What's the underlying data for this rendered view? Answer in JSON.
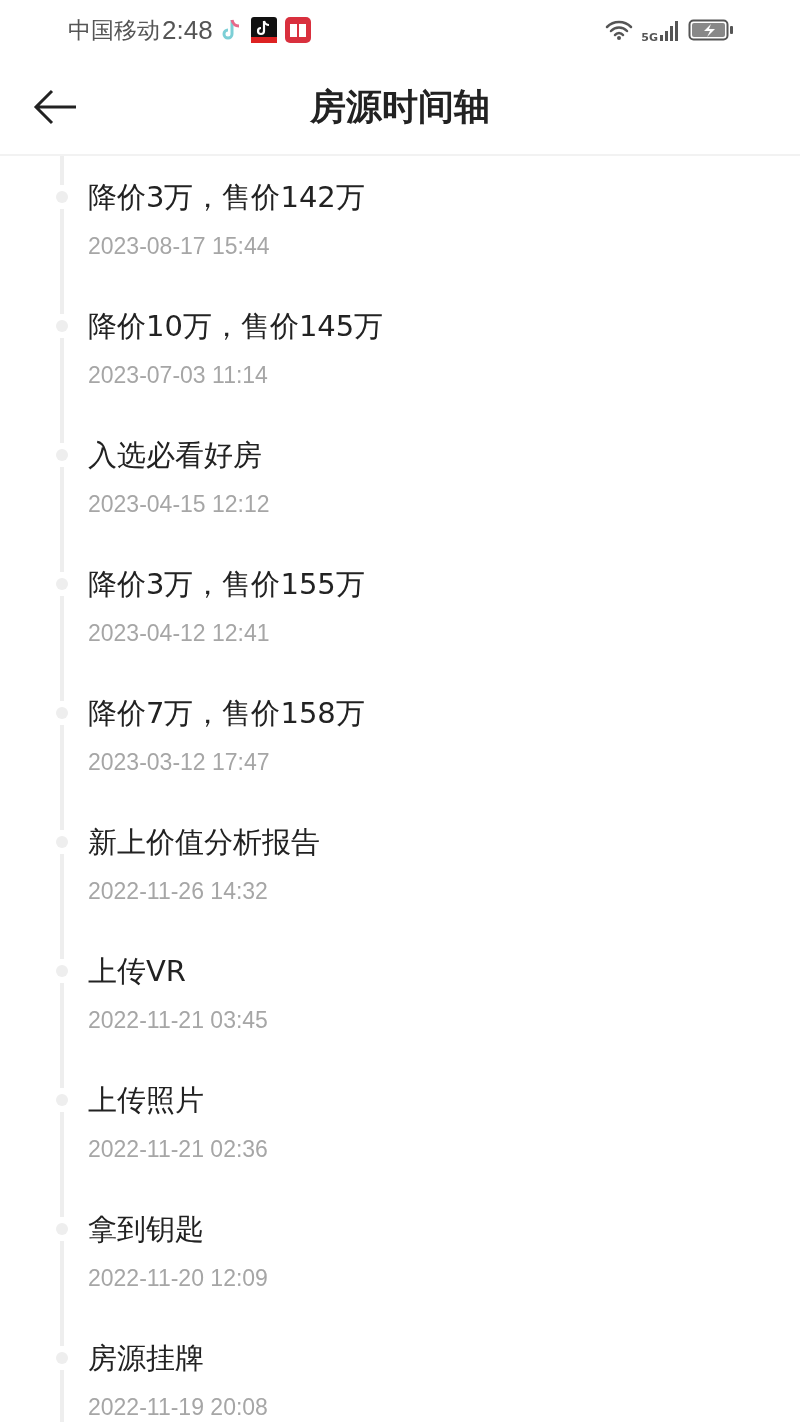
{
  "status_bar": {
    "carrier": "中国移动",
    "time": "2:48",
    "network": "5G"
  },
  "header": {
    "title": "房源时间轴"
  },
  "timeline": [
    {
      "title": "降价3万，售价142万",
      "time": "2023-08-17 15:44"
    },
    {
      "title": "降价10万，售价145万",
      "time": "2023-07-03 11:14"
    },
    {
      "title": "入选必看好房",
      "time": "2023-04-15 12:12"
    },
    {
      "title": "降价3万，售价155万",
      "time": "2023-04-12 12:41"
    },
    {
      "title": "降价7万，售价158万",
      "time": "2023-03-12 17:47"
    },
    {
      "title": "新上价值分析报告",
      "time": "2022-11-26 14:32"
    },
    {
      "title": "上传VR",
      "time": "2022-11-21 03:45"
    },
    {
      "title": "上传照片",
      "time": "2022-11-21 02:36"
    },
    {
      "title": "拿到钥匙",
      "time": "2022-11-20 12:09"
    },
    {
      "title": "房源挂牌",
      "time": "2022-11-19 20:08"
    }
  ]
}
